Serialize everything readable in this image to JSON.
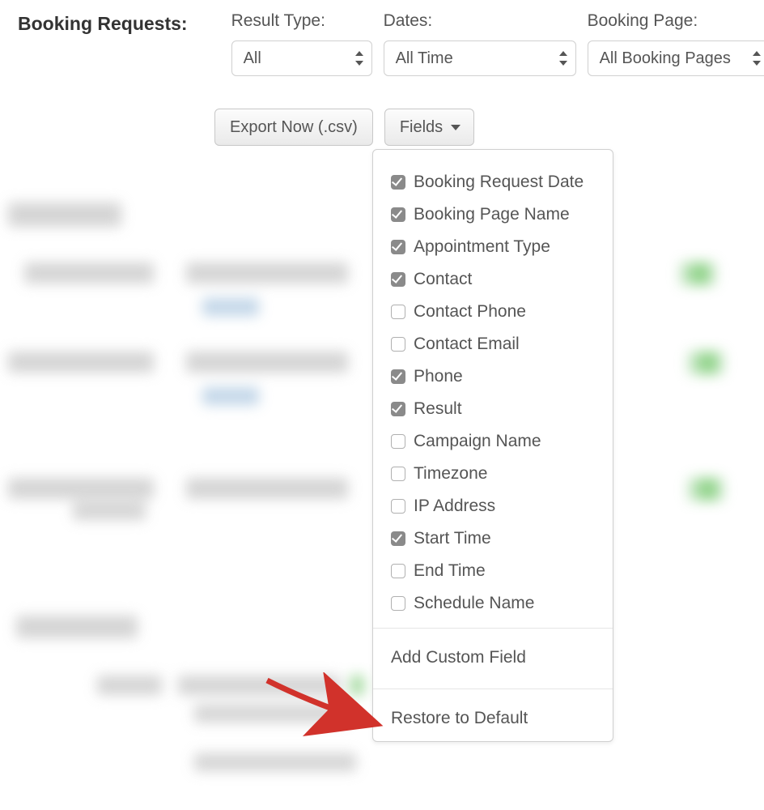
{
  "header": {
    "title": "Booking Requests:"
  },
  "filters": {
    "result_type": {
      "label": "Result Type:",
      "value": "All"
    },
    "dates": {
      "label": "Dates:",
      "value": "All Time"
    },
    "booking_page": {
      "label": "Booking Page:",
      "value": "All Booking Pages"
    }
  },
  "actions": {
    "export_label": "Export Now (.csv)",
    "fields_label": "Fields"
  },
  "fields_menu": {
    "items": [
      {
        "label": "Booking Request Date",
        "checked": true
      },
      {
        "label": "Booking Page Name",
        "checked": true
      },
      {
        "label": "Appointment Type",
        "checked": true
      },
      {
        "label": "Contact",
        "checked": true
      },
      {
        "label": "Contact Phone",
        "checked": false
      },
      {
        "label": "Contact Email",
        "checked": false
      },
      {
        "label": "Phone",
        "checked": true
      },
      {
        "label": "Result",
        "checked": true
      },
      {
        "label": "Campaign Name",
        "checked": false
      },
      {
        "label": "Timezone",
        "checked": false
      },
      {
        "label": "IP Address",
        "checked": false
      },
      {
        "label": "Start Time",
        "checked": true
      },
      {
        "label": "End Time",
        "checked": false
      },
      {
        "label": "Schedule Name",
        "checked": false
      }
    ],
    "add_custom": "Add Custom Field",
    "restore": "Restore to Default"
  }
}
